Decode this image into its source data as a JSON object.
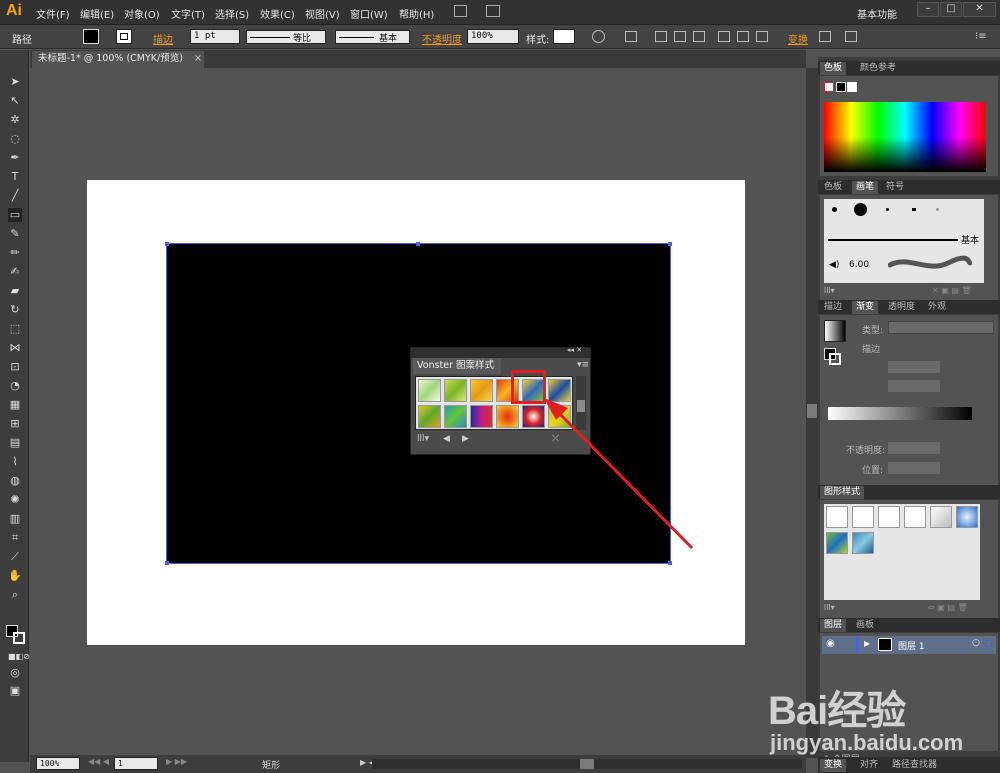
{
  "app": {
    "logo": "Ai",
    "workspace": "基本功能"
  },
  "menu": [
    "文件(F)",
    "编辑(E)",
    "对象(O)",
    "文字(T)",
    "选择(S)",
    "效果(C)",
    "视图(V)",
    "窗口(W)",
    "帮助(H)"
  ],
  "control": {
    "label": "路径",
    "stroke_label": "描边",
    "stroke_weight": "1 pt",
    "profile": "等比",
    "brush": "基本",
    "opacity_label": "不透明度",
    "opacity": "100%",
    "style_label": "样式:",
    "transform": "变换"
  },
  "document": {
    "tab": "未标题-1* @ 100% (CMYK/预览)"
  },
  "floating_panel": {
    "title": "Vonster 图案样式"
  },
  "status": {
    "zoom": "100%",
    "page": "1",
    "tool": "矩形"
  },
  "panels": {
    "color": {
      "tabs": [
        "色板",
        "颜色参考"
      ]
    },
    "swatches": {
      "tabs": [
        "色板",
        "画笔",
        "符号"
      ],
      "brush_basic": "基本",
      "brush_size": "6.00"
    },
    "stroke": {
      "tabs": [
        "描边",
        "渐变",
        "透明度",
        "外观"
      ],
      "type_label": "类型:",
      "stroke_label": "描边",
      "opacity_label": "不透明度:",
      "position_label": "位置:"
    },
    "graphic_styles": {
      "title": "图形样式"
    },
    "layers": {
      "tabs": [
        "图层",
        "画板"
      ],
      "layer_name": "图层 1",
      "count": "1 个图层"
    },
    "bottom": {
      "tabs": [
        "变换",
        "对齐",
        "路径查找器"
      ]
    }
  },
  "watermark": {
    "brand": "Bai经验",
    "url": "jingyan.baidu.com"
  },
  "colors": {
    "accent": "#f39a1a",
    "selection": "#4a64d8",
    "annotation": "#e41e1e"
  }
}
